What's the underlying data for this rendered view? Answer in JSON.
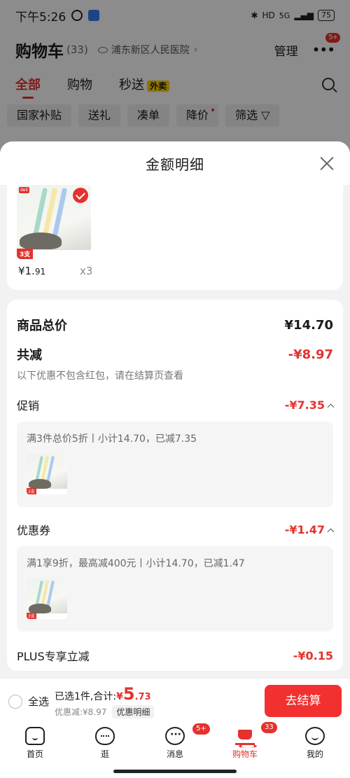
{
  "status": {
    "time": "下午5:26",
    "network": "5G",
    "battery": "75"
  },
  "header": {
    "title": "购物车",
    "count": "(33)",
    "location": "浦东新区人民医院",
    "manage": "管理",
    "more_badge": "5+"
  },
  "tabs": {
    "all": "全部",
    "shopping": "购物",
    "flash": "秒送",
    "waimai": "外卖"
  },
  "filters": [
    "国家补贴",
    "送礼",
    "凑单",
    "降价",
    "筛选"
  ],
  "sheet": {
    "title": "金额明细",
    "product": {
      "price_int": "¥1.",
      "price_dec": "91",
      "quantity": "x3",
      "qty_tag": "3支",
      "brand": "deli"
    },
    "total_label": "商品总价",
    "total_value": "¥14.70",
    "reduce_label": "共减",
    "reduce_value": "-¥8.97",
    "note": "以下优惠不包含红包，请在结算页查看",
    "promo_label": "促销",
    "promo_value": "-¥7.35",
    "promo_detail": "满3件总价5折丨小计14.70，已减7.35",
    "coupon_label": "优惠券",
    "coupon_value": "-¥1.47",
    "coupon_detail": "满1享9折，最高减400元丨小计14.70，已减1.47",
    "plus_label": "PLUS专享立减",
    "plus_value": "-¥0.15"
  },
  "checkout": {
    "select_all": "全选",
    "selected_text": "已选1件,合计:",
    "currency": "¥",
    "price_big": "5",
    "price_dec": ".73",
    "discount_text": "优惠减:¥8.97",
    "detail_button": "优惠明细",
    "checkout_button": "去结算"
  },
  "nav": {
    "items": [
      {
        "label": "首页"
      },
      {
        "label": "逛"
      },
      {
        "label": "消息",
        "badge": "5+"
      },
      {
        "label": "购物车",
        "badge": "33"
      },
      {
        "label": "我的"
      }
    ]
  },
  "colors": {
    "accent": "#e4322e",
    "checkout_button": "#f23030"
  }
}
